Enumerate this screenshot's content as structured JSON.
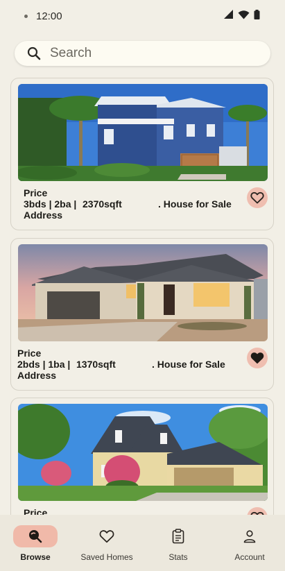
{
  "status_bar": {
    "time": "12:00"
  },
  "search": {
    "placeholder": "Search",
    "icon": "search-icon"
  },
  "listings": [
    {
      "price": "Price",
      "beds_baths": "3bds | 2ba |",
      "sqft": "2370sqft",
      "type": ".  House for Sale",
      "address": "Address",
      "saved": false
    },
    {
      "price": "Price",
      "beds_baths": "2bds | 1ba |",
      "sqft": "1370sqft",
      "type": ".  House for Sale",
      "address": "Address",
      "saved": true
    },
    {
      "price": "Price",
      "beds_baths": "",
      "sqft": "",
      "type": "",
      "address": "",
      "saved": false
    }
  ],
  "nav": {
    "items": [
      {
        "label": "Browse",
        "icon": "browse-icon",
        "active": true
      },
      {
        "label": "Saved Homes",
        "icon": "heart-icon",
        "active": false
      },
      {
        "label": "Stats",
        "icon": "clipboard-icon",
        "active": false
      },
      {
        "label": "Account",
        "icon": "person-icon",
        "active": false
      }
    ]
  },
  "colors": {
    "background": "#f2efe6",
    "accent": "#f0b9a9",
    "favorite_bg": "#efbeb0"
  }
}
